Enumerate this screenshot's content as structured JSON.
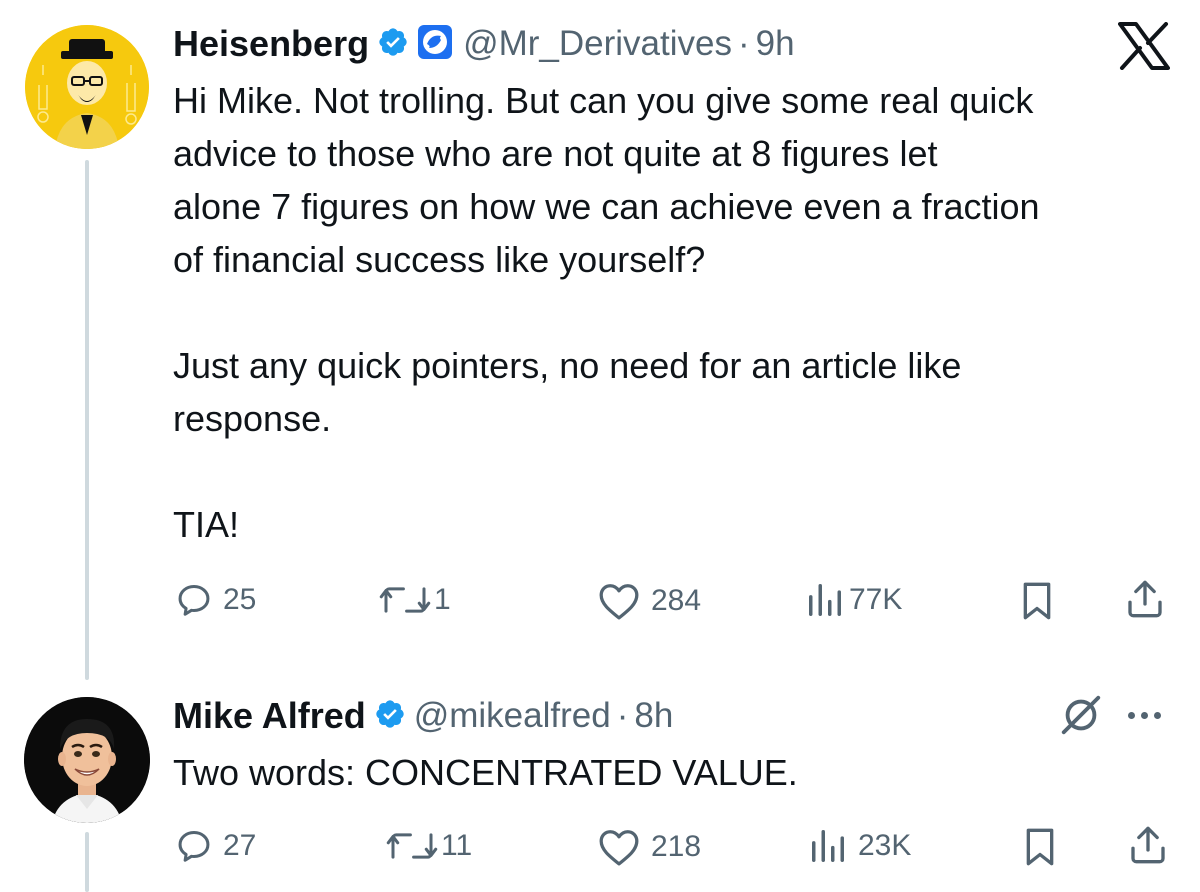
{
  "tweets": [
    {
      "author": {
        "name": "Heisenberg",
        "handle": "@Mr_Derivatives",
        "separator": "·",
        "time": "9h",
        "verified": true,
        "affiliate_badge": "affiliate-bird-badge"
      },
      "text": "Hi Mike. Not trolling. But can you give some real quick\nadvice to those who are not quite at 8 figures let\nalone 7 figures on how we can achieve even a fraction\nof financial success like yourself?\n\nJust any quick pointers, no need for an article like\nresponse.\n\nTIA!",
      "actions": {
        "replies": "25",
        "retweets": "1",
        "likes": "284",
        "views": "77K"
      },
      "corner_icon": "x-logo-icon"
    },
    {
      "author": {
        "name": "Mike Alfred",
        "handle": "@mikealfred",
        "separator": "·",
        "time": "8h",
        "verified": true
      },
      "text": "Two words: CONCENTRATED VALUE.",
      "actions": {
        "replies": "27",
        "retweets": "11",
        "likes": "218",
        "views": "23K"
      },
      "corner_icons": [
        "grok-icon",
        "more-icon"
      ]
    }
  ],
  "colors": {
    "text_primary": "#0f1419",
    "text_secondary": "#536471",
    "verified_blue": "#1d9bf0",
    "thread_line": "#cfd9de",
    "avatar_yellow": "#f6c90e"
  }
}
